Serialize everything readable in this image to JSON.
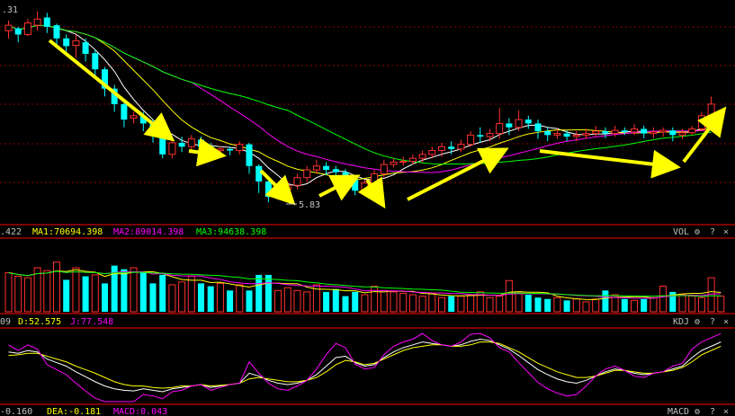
{
  "chart_data": {
    "type": "candlestick",
    "price_panel": {
      "top_label": ".31",
      "low_marker": "5.83",
      "ylim": [
        5.6,
        8.4
      ],
      "grid": true,
      "candles": [
        [
          8.05,
          8.12,
          7.95,
          8.18
        ],
        [
          8.08,
          8.0,
          7.9,
          8.1
        ],
        [
          8.0,
          8.15,
          7.98,
          8.2
        ],
        [
          8.12,
          8.2,
          8.05,
          8.3
        ],
        [
          8.22,
          8.1,
          8.02,
          8.28
        ],
        [
          8.12,
          7.95,
          7.85,
          8.14
        ],
        [
          7.95,
          7.85,
          7.78,
          8.0
        ],
        [
          7.86,
          7.92,
          7.7,
          8.0
        ],
        [
          7.9,
          7.75,
          7.65,
          7.95
        ],
        [
          7.76,
          7.55,
          7.45,
          7.8
        ],
        [
          7.55,
          7.3,
          7.2,
          7.58
        ],
        [
          7.3,
          7.1,
          7.0,
          7.35
        ],
        [
          7.1,
          6.9,
          6.8,
          7.15
        ],
        [
          6.92,
          6.95,
          6.85,
          7.0
        ],
        [
          6.95,
          6.85,
          6.75,
          7.0
        ],
        [
          6.85,
          6.7,
          6.6,
          6.9
        ],
        [
          6.7,
          6.45,
          6.4,
          6.72
        ],
        [
          6.45,
          6.6,
          6.4,
          6.65
        ],
        [
          6.6,
          6.55,
          6.48,
          6.68
        ],
        [
          6.55,
          6.65,
          6.5,
          6.7
        ],
        [
          6.64,
          6.55,
          6.5,
          6.68
        ],
        [
          6.55,
          6.48,
          6.42,
          6.6
        ],
        [
          6.5,
          6.52,
          6.45,
          6.56
        ],
        [
          6.52,
          6.5,
          6.44,
          6.55
        ],
        [
          6.5,
          6.58,
          6.45,
          6.62
        ],
        [
          6.58,
          6.3,
          6.2,
          6.6
        ],
        [
          6.3,
          6.1,
          5.95,
          6.32
        ],
        [
          6.1,
          5.9,
          5.83,
          6.12
        ],
        [
          5.9,
          6.0,
          5.86,
          6.02
        ],
        [
          6.0,
          6.05,
          5.95,
          6.1
        ],
        [
          6.05,
          6.15,
          6.0,
          6.2
        ],
        [
          6.15,
          6.25,
          6.1,
          6.3
        ],
        [
          6.25,
          6.3,
          6.2,
          6.38
        ],
        [
          6.3,
          6.25,
          6.18,
          6.35
        ],
        [
          6.26,
          6.22,
          6.15,
          6.3
        ],
        [
          6.22,
          6.12,
          6.05,
          6.26
        ],
        [
          6.12,
          5.98,
          5.92,
          6.15
        ],
        [
          5.98,
          6.08,
          5.95,
          6.12
        ],
        [
          6.08,
          6.2,
          6.05,
          6.25
        ],
        [
          6.2,
          6.32,
          6.15,
          6.38
        ],
        [
          6.32,
          6.35,
          6.28,
          6.4
        ],
        [
          6.35,
          6.36,
          6.3,
          6.42
        ],
        [
          6.36,
          6.4,
          6.32,
          6.45
        ],
        [
          6.4,
          6.45,
          6.35,
          6.5
        ],
        [
          6.45,
          6.5,
          6.4,
          6.55
        ],
        [
          6.5,
          6.55,
          6.42,
          6.6
        ],
        [
          6.55,
          6.52,
          6.45,
          6.62
        ],
        [
          6.52,
          6.58,
          6.48,
          6.64
        ],
        [
          6.58,
          6.7,
          6.55,
          6.75
        ],
        [
          6.7,
          6.68,
          6.6,
          6.8
        ],
        [
          6.68,
          6.72,
          6.62,
          6.78
        ],
        [
          6.72,
          6.85,
          6.65,
          7.05
        ],
        [
          6.85,
          6.8,
          6.7,
          6.92
        ],
        [
          6.8,
          6.9,
          6.75,
          7.02
        ],
        [
          6.9,
          6.85,
          6.78,
          6.95
        ],
        [
          6.85,
          6.75,
          6.65,
          6.9
        ],
        [
          6.75,
          6.7,
          6.62,
          6.8
        ],
        [
          6.7,
          6.72,
          6.65,
          6.78
        ],
        [
          6.72,
          6.68,
          6.62,
          6.76
        ],
        [
          6.68,
          6.7,
          6.62,
          6.75
        ],
        [
          6.7,
          6.72,
          6.65,
          6.78
        ],
        [
          6.72,
          6.75,
          6.68,
          6.82
        ],
        [
          6.75,
          6.72,
          6.66,
          6.8
        ],
        [
          6.72,
          6.76,
          6.68,
          6.82
        ],
        [
          6.76,
          6.74,
          6.7,
          6.8
        ],
        [
          6.74,
          6.78,
          6.7,
          6.84
        ],
        [
          6.78,
          6.72,
          6.66,
          6.82
        ],
        [
          6.72,
          6.74,
          6.66,
          6.8
        ],
        [
          6.74,
          6.76,
          6.68,
          6.8
        ],
        [
          6.76,
          6.7,
          6.62,
          6.8
        ],
        [
          6.7,
          6.73,
          6.65,
          6.78
        ],
        [
          6.73,
          6.78,
          6.7,
          6.82
        ],
        [
          6.78,
          6.95,
          6.75,
          7.0
        ],
        [
          6.95,
          7.1,
          6.9,
          7.2
        ]
      ],
      "arrows": [
        [
          [
            55,
            45
          ],
          [
            185,
            150
          ]
        ],
        [
          [
            210,
            168
          ],
          [
            240,
            172
          ]
        ],
        [
          [
            290,
            190
          ],
          [
            320,
            220
          ]
        ],
        [
          [
            355,
            218
          ],
          [
            390,
            200
          ]
        ],
        [
          [
            408,
            200
          ],
          [
            422,
            222
          ]
        ],
        [
          [
            453,
            222
          ],
          [
            555,
            170
          ]
        ],
        [
          [
            600,
            168
          ],
          [
            745,
            185
          ]
        ],
        [
          [
            760,
            180
          ],
          [
            800,
            128
          ]
        ]
      ]
    },
    "volume_panel": {
      "legend_prefix": ".422",
      "legend": [
        {
          "label": "MA1:70694.398",
          "color": "#ffff00"
        },
        {
          "label": "MA2:89014.398",
          "color": "#ff00ff"
        },
        {
          "label": "MA3:94638.398",
          "color": "#00ff00"
        }
      ],
      "indicator": "VOL",
      "ylim": [
        0,
        100
      ],
      "values": [
        55,
        50,
        48,
        62,
        58,
        70,
        45,
        62,
        50,
        52,
        40,
        65,
        60,
        62,
        55,
        40,
        52,
        38,
        42,
        50,
        40,
        36,
        40,
        30,
        38,
        30,
        52,
        52,
        30,
        34,
        30,
        28,
        38,
        28,
        32,
        22,
        28,
        24,
        36,
        30,
        28,
        26,
        24,
        22,
        26,
        20,
        22,
        22,
        24,
        28,
        20,
        22,
        44,
        28,
        24,
        20,
        18,
        20,
        16,
        18,
        14,
        18,
        30,
        24,
        18,
        16,
        18,
        20,
        36,
        28,
        24,
        22,
        20,
        48,
        22
      ],
      "up_flags": [
        1,
        1,
        1,
        1,
        1,
        1,
        0,
        1,
        0,
        1,
        0,
        0,
        0,
        1,
        0,
        0,
        0,
        1,
        1,
        1,
        0,
        0,
        1,
        0,
        1,
        0,
        0,
        0,
        1,
        1,
        1,
        1,
        1,
        0,
        0,
        0,
        0,
        1,
        1,
        1,
        1,
        1,
        1,
        1,
        1,
        1,
        0,
        1,
        1,
        1,
        1,
        1,
        1,
        1,
        0,
        0,
        0,
        1,
        0,
        1,
        1,
        1,
        0,
        1,
        0,
        1,
        0,
        1,
        1,
        0,
        1,
        1,
        1,
        1,
        1
      ]
    },
    "kdj_panel": {
      "legend_prefix": "09",
      "legend": [
        {
          "label": "D:52.575",
          "color": "#ffff00"
        },
        {
          "label": "J:77.548",
          "color": "#ff00ff"
        }
      ],
      "indicator": "KDJ",
      "ylim": [
        0,
        100
      ],
      "K": [
        70,
        68,
        72,
        70,
        60,
        55,
        50,
        42,
        35,
        28,
        22,
        18,
        16,
        15,
        18,
        16,
        14,
        18,
        20,
        22,
        24,
        20,
        22,
        24,
        26,
        40,
        36,
        30,
        26,
        24,
        26,
        30,
        38,
        50,
        62,
        64,
        55,
        50,
        52,
        62,
        70,
        76,
        80,
        84,
        82,
        80,
        78,
        80,
        85,
        88,
        86,
        80,
        74,
        65,
        55,
        45,
        38,
        32,
        28,
        26,
        30,
        36,
        42,
        46,
        44,
        40,
        38,
        40,
        42,
        46,
        50,
        62,
        72,
        78,
        84
      ],
      "D": [
        65,
        66,
        68,
        68,
        64,
        60,
        56,
        50,
        45,
        40,
        34,
        28,
        24,
        22,
        22,
        20,
        19,
        20,
        22,
        22,
        24,
        22,
        23,
        24,
        26,
        32,
        34,
        32,
        30,
        28,
        28,
        30,
        34,
        42,
        52,
        58,
        56,
        52,
        54,
        60,
        66,
        72,
        76,
        78,
        80,
        80,
        78,
        78,
        80,
        84,
        84,
        82,
        76,
        70,
        62,
        54,
        48,
        42,
        38,
        34,
        34,
        36,
        40,
        44,
        44,
        42,
        40,
        40,
        42,
        44,
        48,
        56,
        66,
        72,
        78
      ],
      "J": [
        80,
        72,
        80,
        74,
        52,
        45,
        38,
        26,
        15,
        5,
        0,
        0,
        0,
        0,
        10,
        8,
        4,
        14,
        16,
        22,
        24,
        16,
        20,
        24,
        26,
        56,
        40,
        26,
        18,
        16,
        22,
        30,
        46,
        66,
        82,
        76,
        53,
        46,
        48,
        66,
        78,
        84,
        88,
        96,
        86,
        80,
        78,
        84,
        95,
        96,
        90,
        76,
        70,
        55,
        41,
        27,
        18,
        12,
        8,
        10,
        22,
        36,
        46,
        50,
        44,
        36,
        34,
        40,
        42,
        50,
        54,
        74,
        84,
        90,
        96
      ]
    },
    "macd_panel": {
      "legend_prefix": "-0.160",
      "legend": [
        {
          "label": "DEA:-0.181",
          "color": "#ffff00"
        },
        {
          "label": "MACD:0.043",
          "color": "#ff00ff"
        }
      ],
      "indicator": "MACD"
    }
  }
}
